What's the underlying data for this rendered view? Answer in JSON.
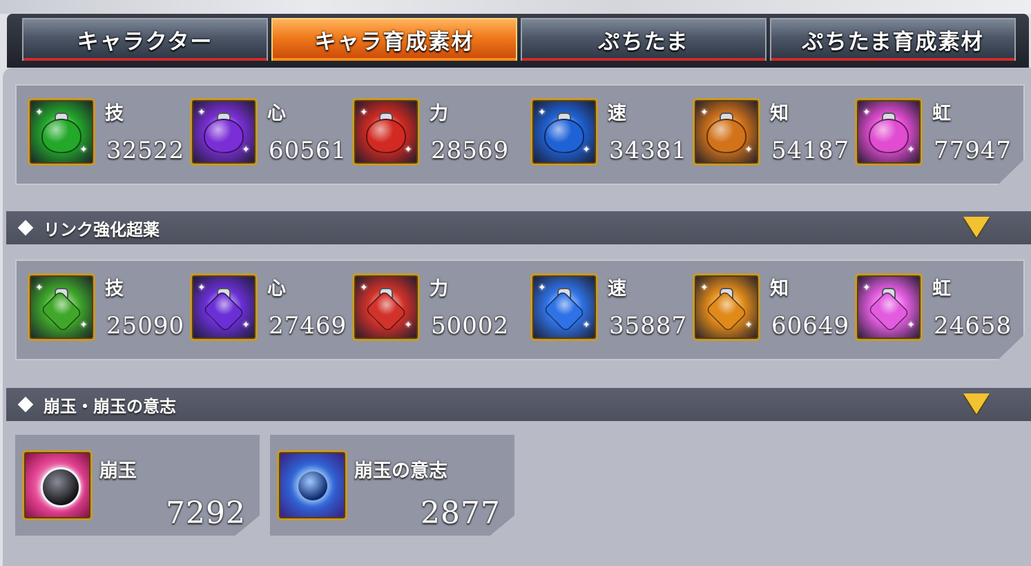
{
  "tabs": [
    {
      "label": "キャラクター",
      "active": false
    },
    {
      "label": "キャラ育成素材",
      "active": true
    },
    {
      "label": "ぷちたま",
      "active": false
    },
    {
      "label": "ぷちたま育成素材",
      "active": false
    }
  ],
  "row1": [
    {
      "label": "技",
      "count": "32522",
      "color": "#23a82a",
      "icon": "green-potion-icon"
    },
    {
      "label": "心",
      "count": "60561",
      "color": "#7a2fd6",
      "icon": "purple-potion-icon"
    },
    {
      "label": "力",
      "count": "28569",
      "color": "#d22a22",
      "icon": "red-potion-icon"
    },
    {
      "label": "速",
      "count": "34381",
      "color": "#1f62d6",
      "icon": "blue-potion-icon"
    },
    {
      "label": "知",
      "count": "54187",
      "color": "#d2731a",
      "icon": "orange-potion-icon"
    },
    {
      "label": "虹",
      "count": "77947",
      "color": "#e14cd1",
      "icon": "rainbow-potion-icon"
    }
  ],
  "section1": {
    "title": "リンク強化超薬"
  },
  "row2": [
    {
      "label": "技",
      "count": "25090",
      "color": "#3fa82a",
      "icon": "green-link-potion-icon"
    },
    {
      "label": "心",
      "count": "27469",
      "color": "#6a2fd6",
      "icon": "purple-link-potion-icon"
    },
    {
      "label": "力",
      "count": "50002",
      "color": "#d2322a",
      "icon": "red-link-potion-icon"
    },
    {
      "label": "速",
      "count": "35887",
      "color": "#2f72e6",
      "icon": "blue-link-potion-icon"
    },
    {
      "label": "知",
      "count": "60649",
      "color": "#e08a1a",
      "icon": "orange-link-potion-icon"
    },
    {
      "label": "虹",
      "count": "24658",
      "color": "#e35ce0",
      "icon": "rainbow-link-potion-icon"
    }
  ],
  "section2": {
    "title": "崩玉・崩玉の意志"
  },
  "hogyoku": [
    {
      "label": "崩玉",
      "count": "7292",
      "icon": "hogyoku-orb-icon"
    },
    {
      "label": "崩玉の意志",
      "count": "2877",
      "icon": "hogyoku-will-icon"
    }
  ]
}
